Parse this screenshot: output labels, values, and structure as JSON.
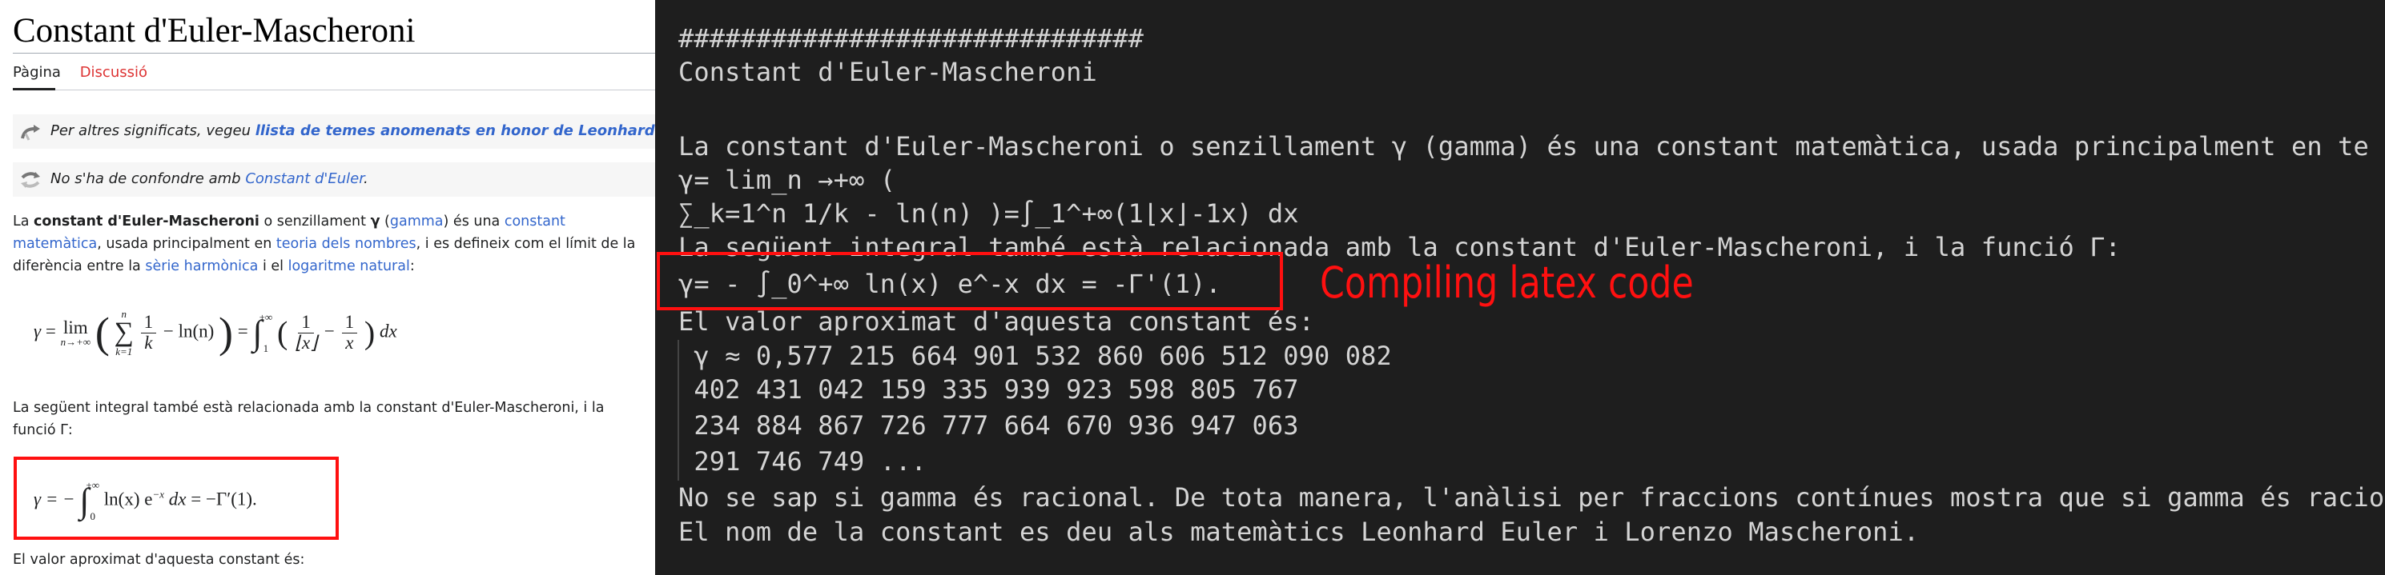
{
  "wiki": {
    "title": "Constant d'Euler-Mascheroni",
    "tabs": [
      {
        "label": "Pàgina",
        "active": true
      },
      {
        "label": "Discussió",
        "active": false
      }
    ],
    "hatnotes": [
      {
        "icon": "disambiguation-arrow-icon",
        "prefix": "Per altres significats, vegeu ",
        "link": "llista de temes anomenats en honor de Leonhard Euler",
        "suffix": ""
      },
      {
        "icon": "confusion-arrows-icon",
        "prefix": "No s'ha de confondre amb ",
        "link": "Constant d'Euler",
        "suffix": "."
      }
    ],
    "intro": {
      "t1": "La ",
      "bold": "constant d'Euler-Mascheroni",
      "t2": " o senzillament ",
      "gamma_bold": "γ",
      "t3": " (",
      "l_gamma": "gamma",
      "t4": ") és una ",
      "l_constant_a": "constant",
      "l_constant_b": "matemàtica",
      "t5": ", usada principalment en ",
      "l_teoria": "teoria dels nombres",
      "t6": ", i es defineix com el límit de la",
      "t7": "diferència entre la ",
      "l_serie": "sèrie harmònica",
      "t8": " i el ",
      "l_log": "logaritme natural",
      "t9": ":"
    },
    "formula1": {
      "gamma": "γ",
      "eq": "=",
      "lim": "lim",
      "lim_sub": "n→+∞",
      "sum": "∑",
      "sum_top": "n",
      "sum_bottom": "k=1",
      "num1": "1",
      "den1": "k",
      "minus": "−",
      "ln": "ln(n)",
      "int": "∫",
      "int_top": "+∞",
      "int_bottom": "1",
      "num2": "1",
      "den2": "⌊x⌋",
      "num3": "1",
      "den3": "x",
      "dx": "dx"
    },
    "para2_line1": "La següent integral també està relacionada amb la constant d'Euler-Mascheroni, i la",
    "para2_line2": "funció Γ:",
    "formula2": {
      "lhs": "γ = −",
      "int": "∫",
      "int_top": "+∞",
      "int_bottom": "0",
      "body": "ln(x) e",
      "exp": "−x",
      "dx": "dx",
      "rhs": "= −Γ′(1)."
    },
    "para3": "El valor aproximat d'aquesta constant és:"
  },
  "terminal": {
    "lines": [
      "##############################",
      "Constant d'Euler-Mascheroni",
      "La constant d'Euler-Mascheroni o senzillament γ (gamma) és una constant matemàtica, usada principalment en te",
      "γ= lim_n →+∞ (",
      "∑_k=1^n 1/k - ln(n) )=∫_1^+∞(1⌊x⌋-1x) dx",
      "La següent integral també està relacionada amb la constant d'Euler-Mascheroni, i la funció Γ:",
      "γ= - ∫_0^+∞ ln(x) e^-x dx = -Γ'(1).",
      "El valor aproximat d'aquesta constant és:",
      " γ ≈ 0,577 215 664 901 532 860 606 512 090 082",
      " 402 431 042 159 335 939 923 598 805 767",
      " 234 884 867 726 777 664 670 936 947 063",
      " 291 746 749 ...",
      "No se sap si gamma és racional. De tota manera, l'anàlisi per fraccions contínues mostra que si gamma és racio",
      "El nom de la constant es deu als matemàtics Leonhard Euler i Lorenzo Mascheroni."
    ]
  },
  "annotation": {
    "label": "Compiling latex code",
    "color": "#ff1010"
  },
  "colors": {
    "link": "#3366cc",
    "redlink": "#dd3333",
    "terminal_bg": "#1e1e1e",
    "terminal_fg": "#d4d4d4"
  }
}
